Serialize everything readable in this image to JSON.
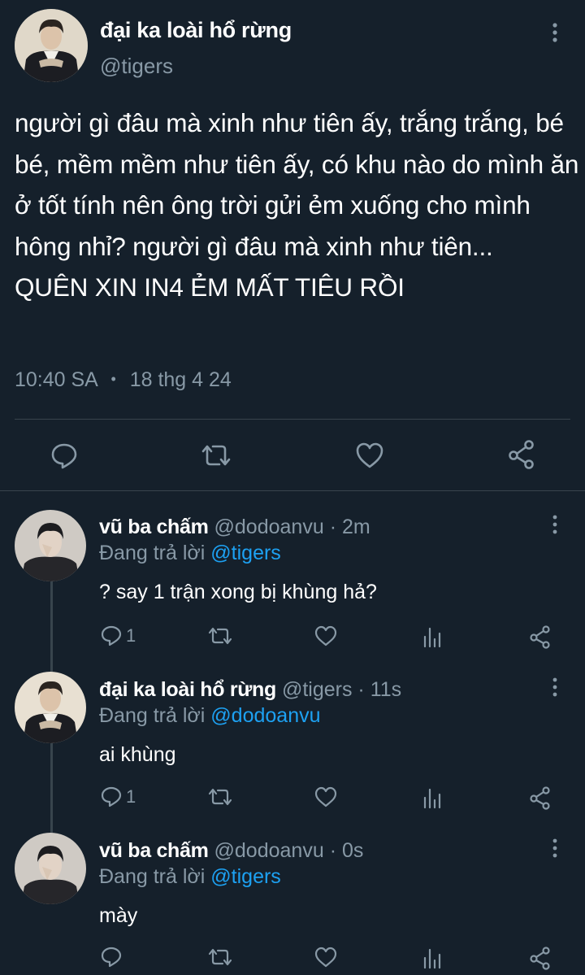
{
  "main_tweet": {
    "name": "đại ka loài hổ rừng",
    "handle": "@tigers",
    "text": "người gì đâu mà xinh như tiên ấy, trắng trắng, bé bé, mềm mềm như tiên ấy, có khu nào do mình ăn ở tốt tính nên ông trời gửi ẻm xuống cho mình hông nhỉ? người gì đâu mà xinh như tiên...\nQUÊN XIN IN4 ẺM MẤT TIÊU RỒI",
    "time": "10:40 SA",
    "dot": "•",
    "date": "18 thg 4 24"
  },
  "replies": [
    {
      "name": "vũ ba chấm",
      "handle": "@dodoanvu",
      "sep": "·",
      "time": "2m",
      "replying_label": "Đang trả lời",
      "replying_to": "@tigers",
      "text": "? say 1 trận xong bị khùng hả?",
      "reply_count": "1"
    },
    {
      "name": "đại ka loài hổ rừng",
      "handle": "@tigers",
      "sep": "·",
      "time": "11s",
      "replying_label": "Đang trả lời",
      "replying_to": "@dodoanvu",
      "text": "ai khùng",
      "reply_count": "1"
    },
    {
      "name": "vũ ba chấm",
      "handle": "@dodoanvu",
      "sep": "·",
      "time": "0s",
      "replying_label": "Đang trả lời",
      "replying_to": "@tigers",
      "text": "mày",
      "reply_count": ""
    }
  ],
  "colors": {
    "background": "#15202b",
    "text_primary": "#ffffff",
    "text_secondary": "#8899a6",
    "link": "#1da1f2",
    "divider": "#38444d"
  },
  "icons": {
    "reply": "reply-icon",
    "retweet": "retweet-icon",
    "like": "heart-icon",
    "analytics": "analytics-icon",
    "share": "share-icon",
    "more": "more-vertical-icon"
  }
}
